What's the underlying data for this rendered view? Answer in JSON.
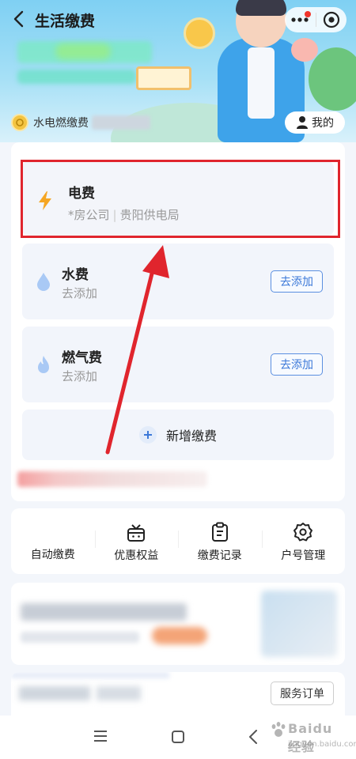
{
  "header": {
    "title": "生活缴费"
  },
  "banner": {
    "badge_text": "水电燃缴费",
    "mine_label": "我的"
  },
  "bills": {
    "electricity": {
      "title": "电费",
      "account": "*房公司",
      "provider": "贵阳供电局"
    },
    "water": {
      "title": "水费",
      "status": "去添加",
      "action": "去添加"
    },
    "gas": {
      "title": "燃气费",
      "status": "去添加",
      "action": "去添加"
    },
    "add_new_label": "新增缴费"
  },
  "quick_actions": [
    {
      "label": "自动缴费",
      "icon": "auto-pay-icon"
    },
    {
      "label": "优惠权益",
      "icon": "gift-icon"
    },
    {
      "label": "缴费记录",
      "icon": "clipboard-icon"
    },
    {
      "label": "户号管理",
      "icon": "gear-icon"
    }
  ],
  "service": {
    "order_label": "服务订单"
  },
  "watermark": {
    "main": "Baidu 经验",
    "sub": "jingyan.baidu.com"
  },
  "colors": {
    "accent_blue": "#3b78d8",
    "highlight_red": "#e0252d",
    "lightning": "#f5a623",
    "water_drop": "#a9c9f5"
  }
}
